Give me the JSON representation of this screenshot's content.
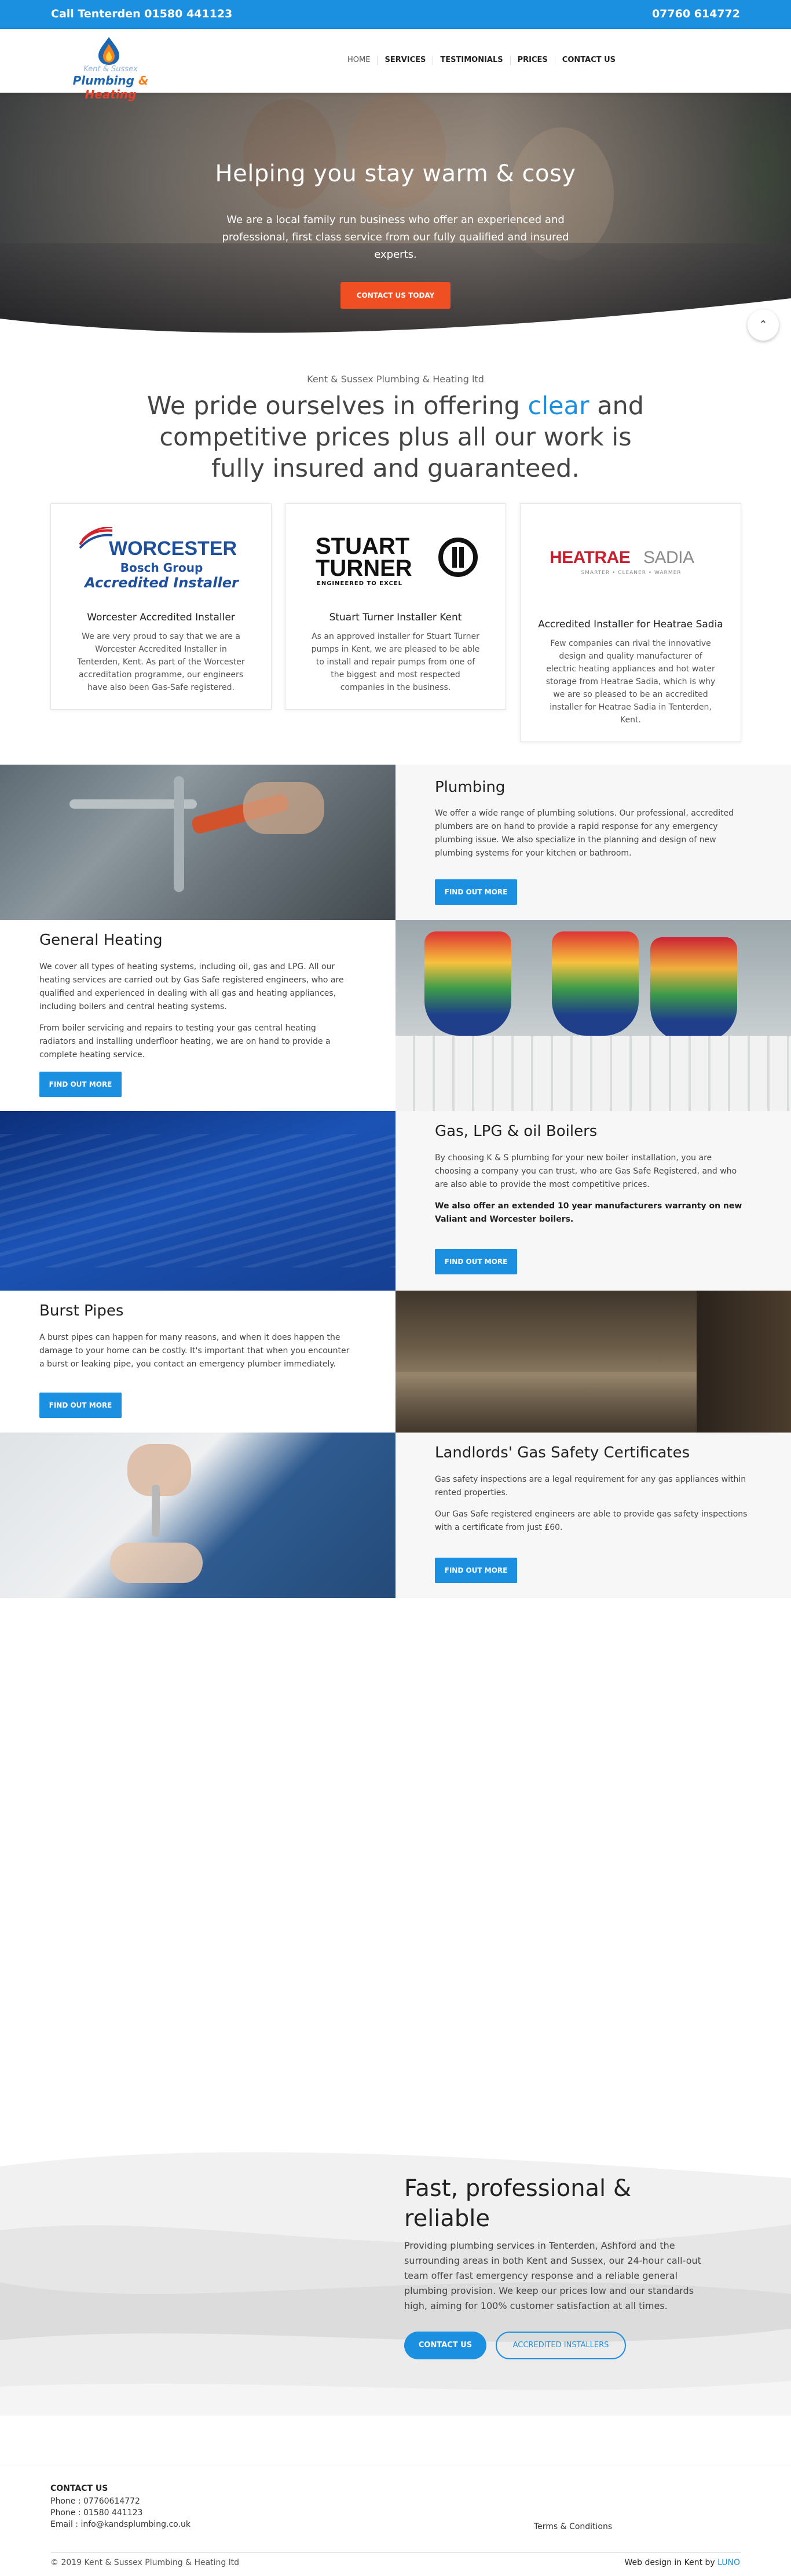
{
  "topbar": {
    "call": "Call Tenterden 01580 441123",
    "mobile": "07760 614772"
  },
  "logo": {
    "line1": "Kent & Sussex",
    "line2_a": "Plumbing",
    "line2_amp": " & ",
    "line2_b": "Heating"
  },
  "nav": {
    "items": [
      {
        "label": "HOME"
      },
      {
        "label": "SERVICES"
      },
      {
        "label": "TESTIMONIALS"
      },
      {
        "label": "PRICES"
      },
      {
        "label": "CONTACT US"
      }
    ]
  },
  "hero": {
    "title": "Helping you stay warm & cosy",
    "text": "We are a local family run business who offer an experienced and professional, first class service from our fully qualified and insured experts.",
    "button": "CONTACT US TODAY"
  },
  "intro": {
    "subtitle": "Kent & Sussex Plumbing & Heating ltd",
    "title_a": "We pride ourselves in offering ",
    "title_highlight": "clear",
    "title_b": " and competitive prices plus all our work is fully insured and guaranteed."
  },
  "cards": [
    {
      "logo_text_1": "WORCESTER",
      "logo_text_2": "Bosch Group",
      "logo_text_3": "Accredited Installer",
      "title": "Worcester Accredited Installer",
      "text": "We are very proud to say that we are a Worcester Accredited Installer in Tenterden, Kent. As part of the Worcester accreditation programme, our engineers have also been Gas-Safe registered."
    },
    {
      "logo_text_1": "STUART",
      "logo_text_2": "TURNER",
      "logo_text_3": "ENGINEERED TO EXCEL",
      "title": "Stuart Turner Installer Kent",
      "text": "As an approved installer for Stuart Turner pumps in Kent, we are pleased to be able to install and repair pumps from one of the biggest and most respected companies in the business."
    },
    {
      "logo_text_1": "HEATRAE",
      "logo_text_2": "SADIA",
      "logo_text_3": "SMARTER • CLEANER • WARMER",
      "title": "Accredited Installer for Heatrae Sadia",
      "text": "Few companies can rival the innovative design and quality manufacturer of electric heating appliances and hot water storage from Heatrae Sadia, which is why we are so pleased to be an accredited installer for Heatrae Sadia in Tenterden, Kent."
    }
  ],
  "services": [
    {
      "title": "Plumbing",
      "paragraphs": [
        "We offer a wide range of plumbing solutions. Our professional, accredited plumbers are on hand to provide a rapid response for any emergency plumbing issue. We also specialize in the planning and design of new plumbing systems for your kitchen or bathroom."
      ],
      "button": "FIND OUT MORE"
    },
    {
      "title": "General Heating",
      "paragraphs": [
        "We cover all types of heating systems, including oil, gas and LPG. All our heating services are carried out by Gas Safe registered engineers, who are qualified and experienced in dealing with all gas and heating appliances, including boilers and central heating systems.",
        "From boiler servicing and repairs to testing your gas central heating radiators and installing underfloor heating, we are on hand to provide a complete heating service."
      ],
      "button": "FIND OUT MORE"
    },
    {
      "title": "Gas, LPG & oil Boilers",
      "paragraphs": [
        "By choosing K & S plumbing for your new boiler installation, you are choosing a company you can trust, who are Gas Safe Registered, and who are also able to provide the most competitive prices."
      ],
      "bold": "We also offer an extended 10 year manufacturers warranty on new Valiant and Worcester boilers.",
      "button": "FIND OUT MORE"
    },
    {
      "title": "Burst Pipes",
      "paragraphs": [
        "A burst pipes can happen for many reasons, and when it does happen the damage to your home can be costly. It's important that when you encounter a burst or leaking pipe, you contact an emergency plumber immediately."
      ],
      "button": "FIND OUT MORE"
    },
    {
      "title": "Landlords' Gas Safety Certificates",
      "paragraphs": [
        "Gas safety inspections are a legal requirement for any gas appliances within rented properties.",
        "Our Gas Safe registered engineers are able to provide gas safety inspections with a certificate from just £60."
      ],
      "button": "FIND OUT MORE"
    }
  ],
  "cta": {
    "title": "Fast, professional & reliable",
    "text": "Providing plumbing services in Tenterden, Ashford and the surrounding areas in both Kent and Sussex, our 24-hour call-out team offer fast emergency response and a reliable general plumbing provision. We keep our prices low and our standards high, aiming for 100% customer satisfaction at all times.",
    "button1": "CONTACT US",
    "button2": "ACCREDITED INSTALLERS"
  },
  "footer": {
    "heading": "CONTACT US",
    "phone1": "Phone : 07760614772",
    "phone2": "Phone : 01580 441123",
    "email": "Email : info@kandsplumbing.co.uk",
    "terms": "Terms & Conditions",
    "copyright": "© 2019 Kent & Sussex Plumbing & Heating ltd",
    "credit_a": "Web design in Kent by ",
    "credit_b": "LUNO"
  },
  "colors": {
    "brand_blue": "#1b8fe0",
    "hero_button": "#f04e23"
  },
  "icons": {
    "scroll": "chevron-up-icon",
    "logo": "flame-drop-icon"
  }
}
